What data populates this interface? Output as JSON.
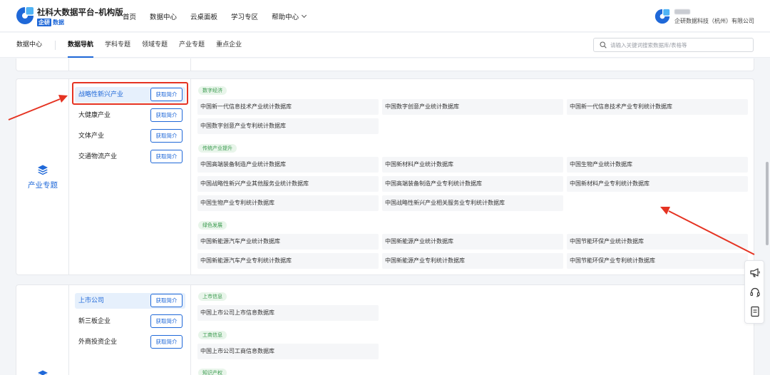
{
  "header": {
    "title": "社科大数据平台–机构版",
    "badge": "企研",
    "badge_suffix": "数据",
    "nav": [
      "首页",
      "数据中心",
      "云桌面板",
      "学习专区",
      "帮助中心"
    ],
    "company": "企研数据科技（杭州）有限公司"
  },
  "subnav": {
    "data_center": "数据中心",
    "tabs": [
      "数据导航",
      "学科专题",
      "领域专题",
      "产业专题",
      "重点企业"
    ],
    "active_tab": "数据导航",
    "search_placeholder": "请输入关键词搜索数据库/表格等"
  },
  "industry": {
    "label": "产业专题",
    "icon": "layers-icon",
    "intro_label": "获取简介",
    "categories": [
      "战略性新兴产业",
      "大健康产业",
      "文体产业",
      "交通物流产业"
    ],
    "active_category": "战略性新兴产业",
    "groups": [
      {
        "tag": "数字经济",
        "databases": [
          "中国新一代信息技术产业统计数据库",
          "中国数字创意产业统计数据库",
          "中国新一代信息技术产业专利统计数据库",
          "中国数字创意产业专利统计数据库"
        ]
      },
      {
        "tag": "传统产业提升",
        "databases": [
          "中国高端装备制造产业统计数据库",
          "中国新材料产业统计数据库",
          "中国生物产业统计数据库",
          "中国战略性新兴产业其他服务业统计数据库",
          "中国高端装备制造产业专利统计数据库",
          "中国新材料产业专利统计数据库",
          "中国生物产业专利统计数据库",
          "中国战略性新兴产业相关服务业专利统计数据库"
        ]
      },
      {
        "tag": "绿色发展",
        "databases": [
          "中国新能源汽车产业统计数据库",
          "中国新能源产业统计数据库",
          "中国节能环保产业统计数据库",
          "中国新能源汽车产业专利统计数据库",
          "中国新能源产业专利统计数据库",
          "中国节能环保产业专利统计数据库"
        ]
      }
    ]
  },
  "enterprise": {
    "categories": [
      "上市公司",
      "新三板企业",
      "外商投资企业"
    ],
    "active_category": "上市公司",
    "groups": [
      {
        "tag": "上市信息",
        "databases": [
          "中国上市公司上市信息数据库"
        ]
      },
      {
        "tag": "工商信息",
        "databases": [
          "中国上市公司工商信息数据库"
        ]
      },
      {
        "tag": "知识产权",
        "databases": []
      }
    ]
  },
  "toolbar_icons": [
    "megaphone-icon",
    "headset-icon",
    "document-icon"
  ],
  "colors": {
    "primary": "#1f68d8",
    "tag_green": "#3a9a4e",
    "annotation_red": "#e53322"
  }
}
